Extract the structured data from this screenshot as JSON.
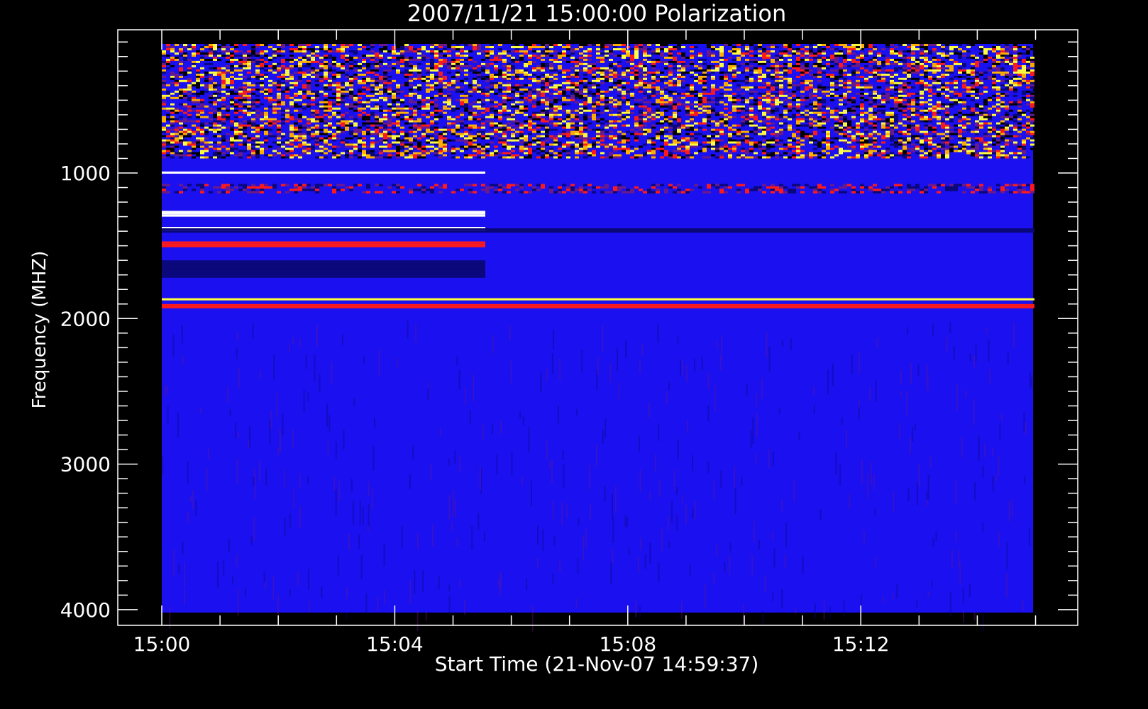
{
  "chart_data": {
    "type": "heatmap",
    "title": "2007/11/21 15:00:00 Polarization",
    "xlabel": "Start Time (21-Nov-07 14:59:37)",
    "ylabel": "Frequency (MHZ)",
    "x_tick_labels": [
      "15:00",
      "15:04",
      "15:08",
      "15:12"
    ],
    "y_tick_labels": [
      "1000",
      "2000",
      "3000",
      "4000"
    ],
    "y_major_ticks": [
      1000,
      2000,
      3000,
      4000
    ],
    "y_minor_step": 100,
    "x_major_minutes": [
      0,
      4,
      8,
      12
    ],
    "x_minor_step_minutes": 1,
    "xlim_minutes": [
      0,
      15
    ],
    "ylim": [
      100,
      4000
    ],
    "y_inverted": true,
    "grid": false,
    "colors": {
      "background": "#000000",
      "base": "#1a10f0",
      "deep": "#0a0878",
      "mid": "#6a1a8a",
      "hot": "#ff1a1a",
      "warm": "#ffb000",
      "bright": "#ffff40",
      "white": "#ffffff"
    },
    "bands": [
      {
        "f1": 100,
        "f2": 900,
        "t1": 0,
        "t2": 15,
        "level": "noisy"
      },
      {
        "f1": 990,
        "f2": 1005,
        "t1": 0,
        "t2": 5.5,
        "level": "white"
      },
      {
        "f1": 1075,
        "f2": 1140,
        "t1": 0,
        "t2": 15,
        "level": "speckled"
      },
      {
        "f1": 1260,
        "f2": 1300,
        "t1": 0,
        "t2": 5.5,
        "level": "white"
      },
      {
        "f1": 1370,
        "f2": 1400,
        "t1": 0,
        "t2": 5.5,
        "level": "white"
      },
      {
        "f1": 1380,
        "f2": 1410,
        "t1": 0,
        "t2": 15,
        "level": "dark"
      },
      {
        "f1": 1470,
        "f2": 1510,
        "t1": 0,
        "t2": 5.5,
        "level": "hot"
      },
      {
        "f1": 1600,
        "f2": 1720,
        "t1": 0,
        "t2": 5.5,
        "level": "dark"
      },
      {
        "f1": 1860,
        "f2": 1875,
        "t1": 0,
        "t2": 15,
        "level": "bright"
      },
      {
        "f1": 1900,
        "f2": 1930,
        "t1": 0,
        "t2": 15,
        "level": "hot"
      }
    ]
  }
}
